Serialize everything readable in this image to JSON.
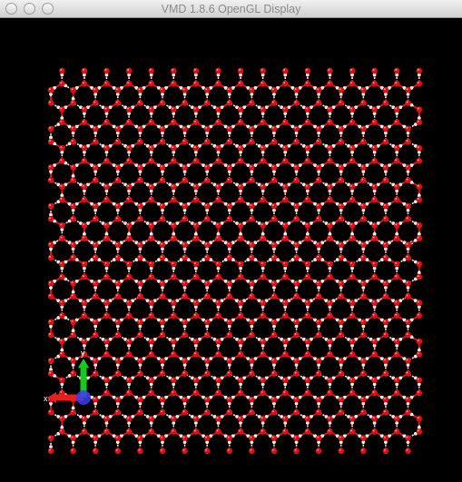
{
  "window": {
    "title": "VMD 1.8.6 OpenGL Display",
    "buttons": [
      "close",
      "minimize",
      "zoom"
    ]
  },
  "viewport": {
    "background": "#000000",
    "scene": "hexagonal ice lattice of water molecules (ball-and-stick)",
    "colors": {
      "oxygen": "#e01010",
      "hydrogen": "#ececec",
      "bond_oxygen": "#d41414",
      "bond_hydrogen": "#e6e6e6"
    },
    "axes_widget": {
      "labels": [
        "x",
        "y"
      ],
      "colors": {
        "x": "#e61e1e",
        "y": "#19c819",
        "z": "#3c3cf0"
      }
    }
  }
}
